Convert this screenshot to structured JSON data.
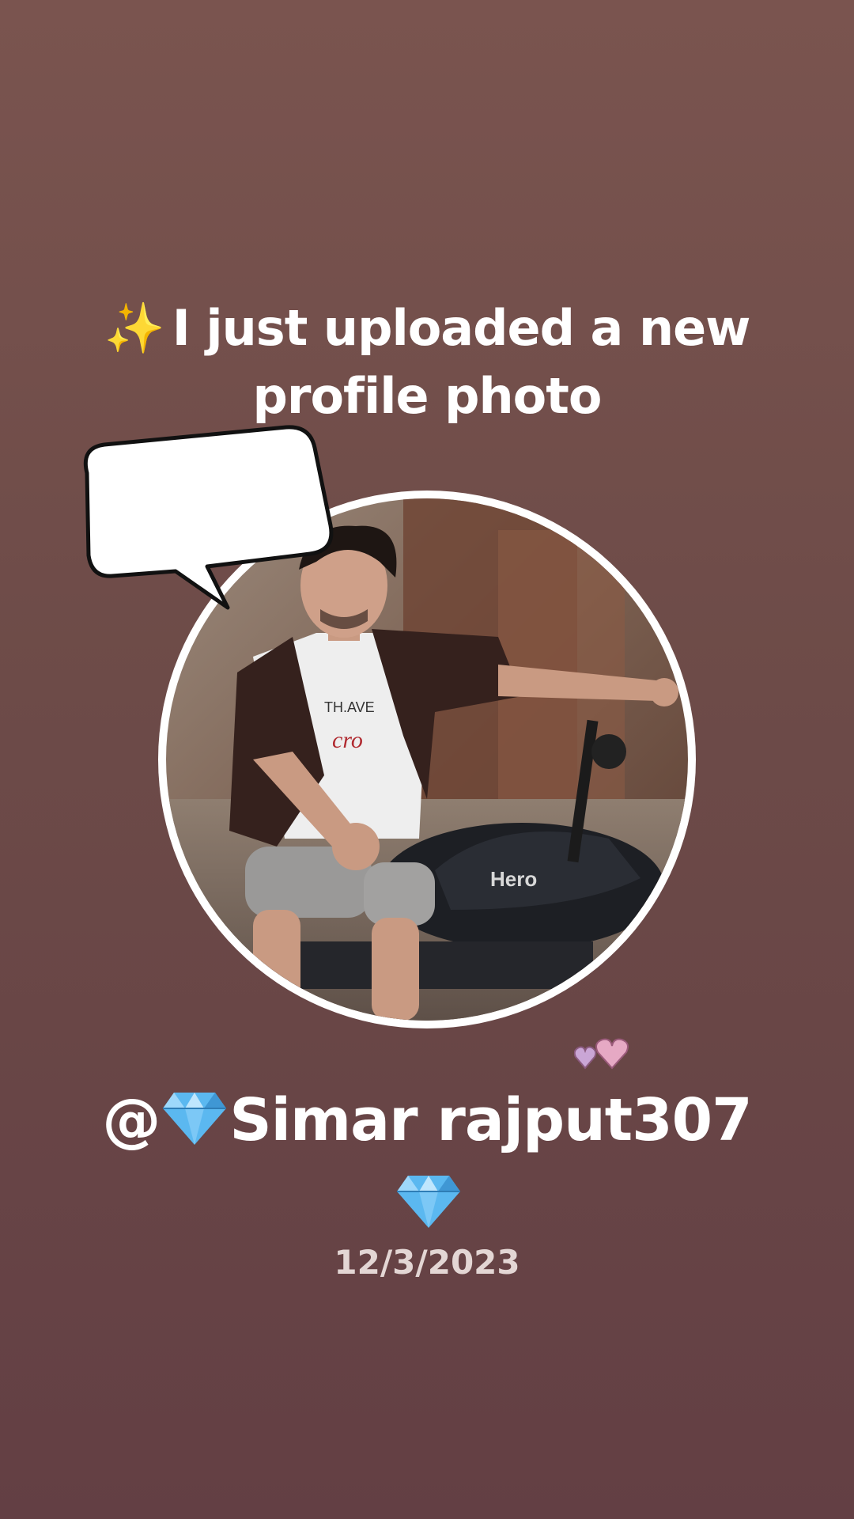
{
  "headline": {
    "sparkle": "✨",
    "text": "I just uploaded a new profile photo"
  },
  "speech_bubble": {
    "text": ""
  },
  "profile_photo": {
    "description_icon": "profile-photo",
    "bike_brand": "Hero"
  },
  "decorations": {
    "hearts_icon": "two-hearts-icon",
    "gem_icon": "gem-stone-icon"
  },
  "handle": {
    "prefix": "@",
    "name": "Simar rajput307"
  },
  "date": "12/3/2023",
  "colors": {
    "background_top": "#7a544f",
    "background_bottom": "#633f44",
    "text": "#ffffff",
    "date_text": "#e3d6d4",
    "gem": "#5bb8f0",
    "sparkle": "#f6c934"
  }
}
